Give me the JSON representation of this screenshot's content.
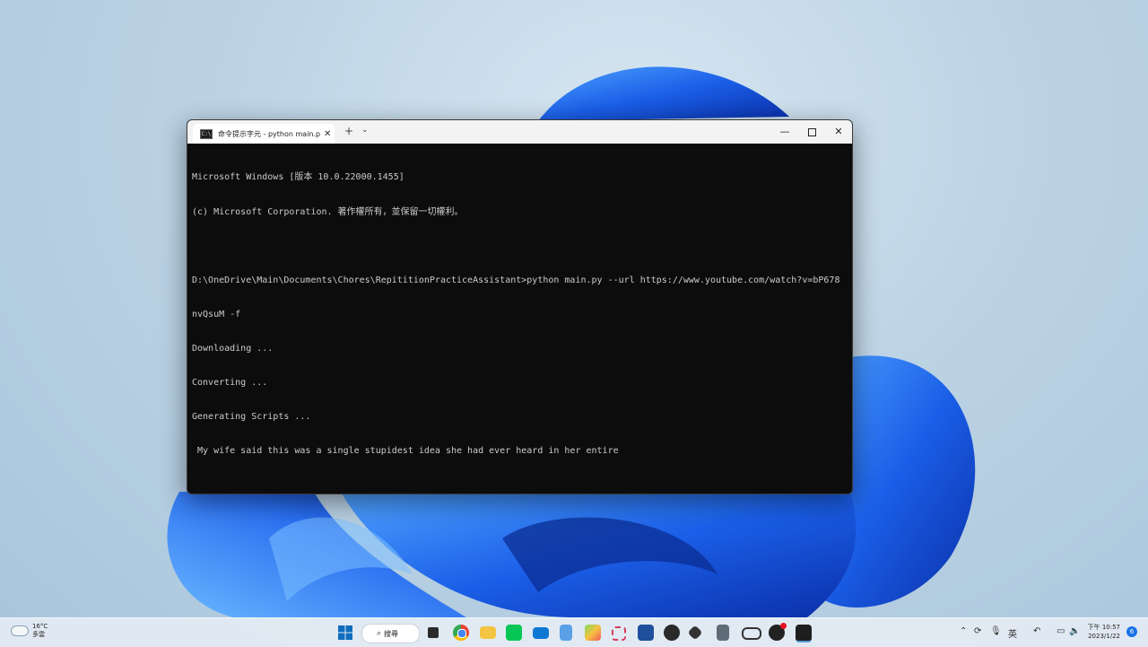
{
  "terminal": {
    "tab_title": "命令提示字元 - python  main.py",
    "cmd_icon_label": "C:\\",
    "new_tab_label": "+",
    "dropdown_label": "⌄",
    "tab_close_label": "✕",
    "minimize_label": "—",
    "close_label": "✕",
    "lines": [
      "Microsoft Windows [版本 10.0.22000.1455]",
      "(c) Microsoft Corporation. 著作權所有，並保留一切權利。",
      "",
      "D:\\OneDrive\\Main\\Documents\\Chores\\RepititionPracticeAssistant>python main.py --url https://www.youtube.com/watch?v=bP678",
      "nvQsuM -f",
      "Downloading ...",
      "Converting ...",
      "Generating Scripts ...",
      " My wife said this was a single stupidest idea she had ever heard in her entire"
    ]
  },
  "taskbar": {
    "weather_temp": "16°C",
    "weather_desc": "多雲",
    "search_label": "搜尋",
    "search_icon": "search-icon",
    "tray_input_method": "英",
    "clock_period_time": "下午 10:57",
    "clock_date": "2023/1/22",
    "notification_count": "6"
  },
  "colors": {
    "console_bg": "#0c0c0c",
    "console_text": "#cccccc",
    "wallpaper_blue": "#1f5fe0"
  }
}
